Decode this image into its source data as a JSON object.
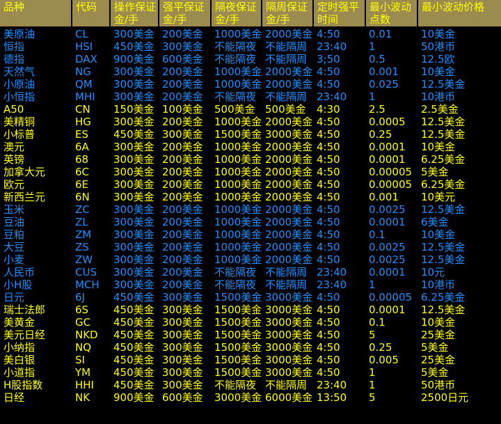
{
  "table": {
    "headers": [
      "品种",
      "代码",
      "操作保证\n金/手",
      "强平保证\n金/手",
      "隔夜保证\n金/手",
      "隔周保证\n金/手",
      "定时强平\n时间",
      "最小波动\n点数",
      "最小波动价格"
    ],
    "colors": {
      "header_bg": "#9b8b4e",
      "header_text": "#ffff00",
      "body_bg": "#000000",
      "row_blue": "#1f8fff",
      "row_yellow": "#ffff00",
      "grid_line": "#000000"
    },
    "rows": [
      {
        "color": "blue",
        "cells": [
          "美原油",
          "CL",
          "300美金",
          "200美金",
          "1000美金",
          "2000美金",
          "4:50",
          "0.01",
          "10美金"
        ]
      },
      {
        "color": "blue",
        "cells": [
          "恒指",
          "HSI",
          "450美金",
          "300美金",
          "不能隔夜",
          "不能隔周",
          "23:40",
          "1",
          "50港币"
        ]
      },
      {
        "color": "blue",
        "cells": [
          "德指",
          "DAX",
          "900美金",
          "600美金",
          "不能隔夜",
          "不能隔周",
          "3;50",
          "0.5",
          "12.5欧"
        ]
      },
      {
        "color": "blue",
        "cells": [
          "天然气",
          "NG",
          "300美金",
          "200美金",
          "1000美金",
          "2000美金",
          "4:50",
          "0.001",
          "10美金"
        ]
      },
      {
        "color": "blue",
        "cells": [
          "小原油",
          "QM",
          "300美金",
          "200美金",
          "1000美金",
          "2000美金",
          "4:50",
          "0.025",
          "12.5美金"
        ]
      },
      {
        "color": "blue",
        "cells": [
          "小恒指",
          "MHI",
          "300美金",
          "200美金",
          "不能隔夜",
          "不能隔周",
          "23:40",
          "1",
          "10港币"
        ]
      },
      {
        "color": "yellow",
        "cells": [
          "A50",
          "CN",
          "150美金",
          "100美金",
          "500美金",
          "500美金",
          "4:30",
          "2.5",
          "2.5美金"
        ]
      },
      {
        "color": "yellow",
        "cells": [
          "美精铜",
          "HG",
          "300美金",
          "200美金",
          "1000美金",
          "2000美金",
          "4:50",
          "0.0005",
          "12.5美金"
        ]
      },
      {
        "color": "yellow",
        "cells": [
          "小标普",
          "ES",
          "450美金",
          "300美金",
          "1500美金",
          "3000美金",
          "4:50",
          "0.25",
          "12.5美金"
        ]
      },
      {
        "color": "yellow",
        "cells": [
          "澳元",
          "6A",
          "300美金",
          "200美金",
          "1000美金",
          "2000美金",
          "4:50",
          "0.0001",
          "10美金"
        ]
      },
      {
        "color": "yellow",
        "cells": [
          "英镑",
          "68",
          "300美金",
          "200美金",
          "1000美金",
          "2000美金",
          "4:50",
          "0.0001",
          "6.25美金"
        ]
      },
      {
        "color": "yellow",
        "cells": [
          "加拿大元",
          "6C",
          "300美金",
          "200美金",
          "1000美金",
          "2000美金",
          "4:50",
          "0.00005",
          "5美金"
        ]
      },
      {
        "color": "yellow",
        "cells": [
          "欧元",
          "6E",
          "300美金",
          "200美金",
          "1000美金",
          "2000美金",
          "4:50",
          "0.00005",
          "6.25美金"
        ]
      },
      {
        "color": "yellow",
        "cells": [
          "新西兰元",
          "6N",
          "300美金",
          "200美金",
          "1000美金",
          "2000美金",
          "4:50",
          "0.001",
          "10美元"
        ]
      },
      {
        "color": "blue",
        "cells": [
          "玉米",
          "ZC",
          "300美金",
          "200美金",
          "1000美金",
          "2000美金",
          "4:50",
          "0.0025",
          "12.5美金"
        ]
      },
      {
        "color": "blue",
        "cells": [
          "豆油",
          "ZL",
          "300美金",
          "200美金",
          "1000美金",
          "2000美金",
          "4:50",
          "0.0001",
          "6美金"
        ]
      },
      {
        "color": "blue",
        "cells": [
          "豆粕",
          "ZM",
          "300美金",
          "200美金",
          "1000美金",
          "2000美金",
          "4:50",
          "0.1",
          "10美金"
        ]
      },
      {
        "color": "blue",
        "cells": [
          "大豆",
          "ZS",
          "300美金",
          "200美金",
          "1000美金",
          "2000美金",
          "4:50",
          "0.0025",
          "12.5美金"
        ]
      },
      {
        "color": "blue",
        "cells": [
          "小麦",
          "ZW",
          "300美金",
          "200美金",
          "1000美金",
          "2000美金",
          "4:50",
          "0.0025",
          "12.5美金"
        ]
      },
      {
        "color": "blue",
        "cells": [
          "人民币",
          "CUS",
          "300美金",
          "200美金",
          "不能隔夜",
          "不能隔周",
          "23:40",
          "0.0001",
          "10元"
        ]
      },
      {
        "color": "blue",
        "cells": [
          "小H股",
          "MCH",
          "300美金",
          "200美金",
          "不能隔夜",
          "不能隔周",
          "23:40",
          "1",
          "10港币"
        ]
      },
      {
        "color": "blue",
        "cells": [
          "日元",
          "6J",
          "450美金",
          "300美金",
          "1500美金",
          "3000美金",
          "4:50",
          "0.00005",
          "6.25美金"
        ]
      },
      {
        "color": "yellow",
        "cells": [
          "瑞士法郎",
          "6S",
          "450美金",
          "300美金",
          "1500美金",
          "3000美金",
          "4:50",
          "0.0001",
          "12.5美金"
        ]
      },
      {
        "color": "yellow",
        "cells": [
          "美黄金",
          "GC",
          "450美金",
          "300美金",
          "1500美金",
          "3000美金",
          "4:50",
          "0.1",
          "10美金"
        ]
      },
      {
        "color": "yellow",
        "cells": [
          "美元日经",
          "NKD",
          "450美金",
          "300美金",
          "1500美金",
          "3000美金",
          "4:50",
          "5",
          "25美金"
        ]
      },
      {
        "color": "yellow",
        "cells": [
          "小纳指",
          "NQ",
          "450美金",
          "300美金",
          "1500美金",
          "3000美金",
          "4:50",
          "0.25",
          "5美金"
        ]
      },
      {
        "color": "yellow",
        "cells": [
          "美白银",
          "SI",
          "450美金",
          "300美金",
          "1500美金",
          "3000美金",
          "4:50",
          "0.005",
          "25美金"
        ]
      },
      {
        "color": "yellow",
        "cells": [
          "小道指",
          "YM",
          "450美金",
          "300美金",
          "1500美金",
          "3000美金",
          "4:50",
          "1",
          "5美金"
        ]
      },
      {
        "color": "yellow",
        "cells": [
          "H股指数",
          "HHI",
          "450美金",
          "300美金",
          "不能隔夜",
          "不能隔周",
          "23:40",
          "1",
          "50港币"
        ]
      },
      {
        "color": "yellow",
        "cells": [
          "日经",
          "NK",
          "900美金",
          "600美金",
          "3000美金",
          "6000美金",
          "13:50",
          "5",
          "2500日元"
        ]
      }
    ]
  }
}
